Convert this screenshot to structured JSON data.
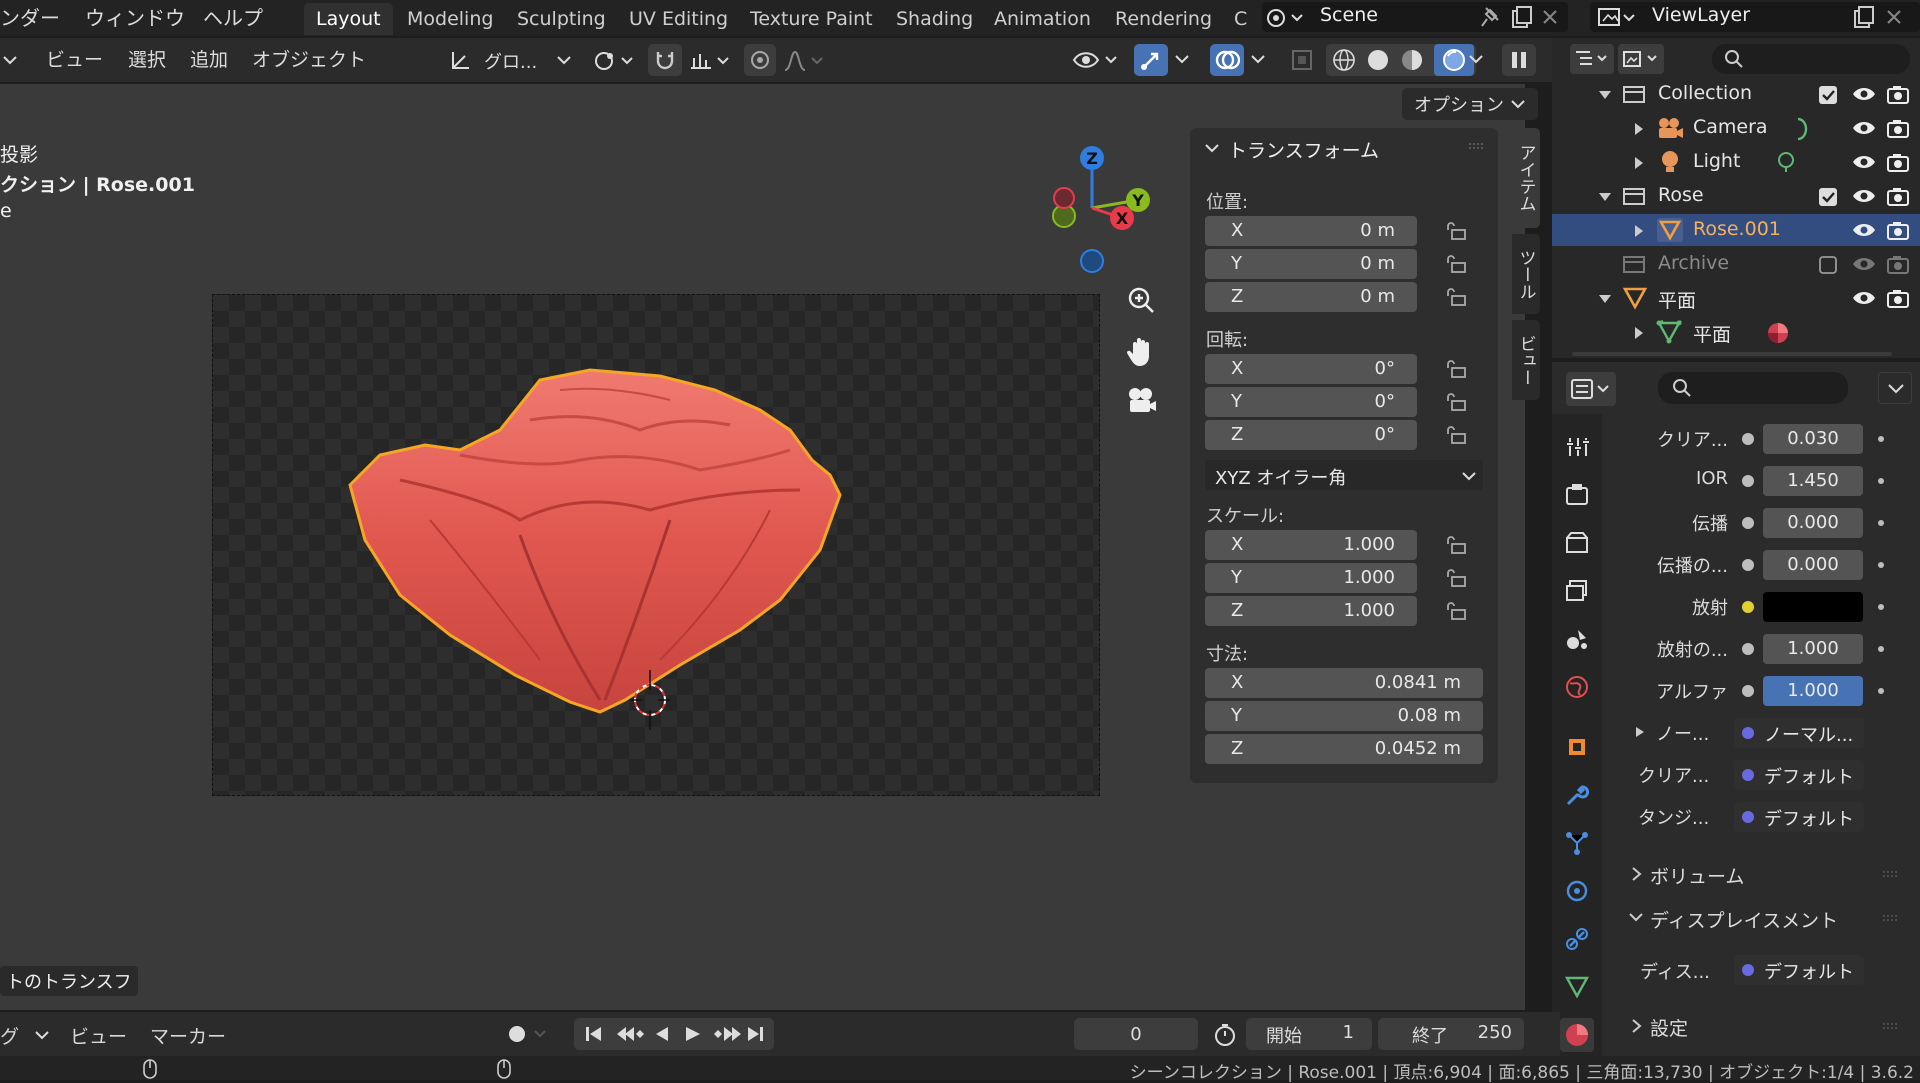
{
  "topbar": {
    "menu": [
      "ンダー",
      "ウィンドウ",
      "ヘルプ"
    ],
    "workspaces": [
      "Layout",
      "Modeling",
      "Sculpting",
      "UV Editing",
      "Texture Paint",
      "Shading",
      "Animation",
      "Rendering",
      "C"
    ],
    "active_workspace": "Layout",
    "scene": "Scene",
    "view_layer": "ViewLayer"
  },
  "header": {
    "menu": [
      "ビュー",
      "選択",
      "追加",
      "オブジェクト"
    ],
    "transform_orientation": "グロ...",
    "options": "オプション"
  },
  "viewport": {
    "overlay_lines": [
      "投影",
      "クション | Rose.001",
      "e"
    ],
    "bottom_left": "トのトランスフ"
  },
  "npanel": {
    "title": "トランスフォーム",
    "location_label": "位置:",
    "location": [
      {
        "axis": "X",
        "value": "0 m"
      },
      {
        "axis": "Y",
        "value": "0 m"
      },
      {
        "axis": "Z",
        "value": "0 m"
      }
    ],
    "rotation_label": "回転:",
    "rotation": [
      {
        "axis": "X",
        "value": "0°"
      },
      {
        "axis": "Y",
        "value": "0°"
      },
      {
        "axis": "Z",
        "value": "0°"
      }
    ],
    "rotation_mode": "XYZ オイラー角",
    "scale_label": "スケール:",
    "scale": [
      {
        "axis": "X",
        "value": "1.000"
      },
      {
        "axis": "Y",
        "value": "1.000"
      },
      {
        "axis": "Z",
        "value": "1.000"
      }
    ],
    "dimensions_label": "寸法:",
    "dimensions": [
      {
        "axis": "X",
        "value": "0.0841 m"
      },
      {
        "axis": "Y",
        "value": "0.08 m"
      },
      {
        "axis": "Z",
        "value": "0.0452 m"
      }
    ],
    "tabs": [
      "アイテム",
      "ツール",
      "ビュー"
    ]
  },
  "outliner": {
    "items": [
      {
        "name": "Collection"
      },
      {
        "name": "Camera"
      },
      {
        "name": "Light"
      },
      {
        "name": "Rose"
      },
      {
        "name": "Rose.001"
      },
      {
        "name": "Archive"
      },
      {
        "name": "平面"
      },
      {
        "name": "平面"
      }
    ]
  },
  "properties": {
    "fields": [
      {
        "label": "クリア...",
        "value": "0.030"
      },
      {
        "label": "IOR",
        "value": "1.450"
      },
      {
        "label": "伝播",
        "value": "0.000"
      },
      {
        "label": "伝播の...",
        "value": "0.000"
      },
      {
        "label": "放射",
        "value": ""
      },
      {
        "label": "放射の...",
        "value": "1.000"
      },
      {
        "label": "アルファ",
        "value": "1.000"
      }
    ],
    "links": [
      {
        "label": "ノー...",
        "value": "ノーマル..."
      },
      {
        "label": "クリア...",
        "value": "デフォルト"
      },
      {
        "label": "タンジ...",
        "value": "デフォルト"
      }
    ],
    "volume": "ボリューム",
    "displacement": "ディスプレイスメント",
    "disp_label": "ディス...",
    "disp_value": "デフォルト",
    "settings": "設定"
  },
  "timeline": {
    "mode": "グ",
    "view": "ビュー",
    "marker": "マーカー",
    "current_frame": "0",
    "start_label": "開始",
    "start": "1",
    "end_label": "終了",
    "end": "250"
  },
  "statusbar": {
    "text": "シーンコレクション | Rose.001 | 頂点:6,904 | 面:6,865 | 三角面:13,730 | オブジェクト:1/4 | 3.6.2"
  },
  "colors": {
    "accent": "#4772b3",
    "selection": "#334d80",
    "outline": "#f5a623",
    "rose": "#e0574f"
  }
}
